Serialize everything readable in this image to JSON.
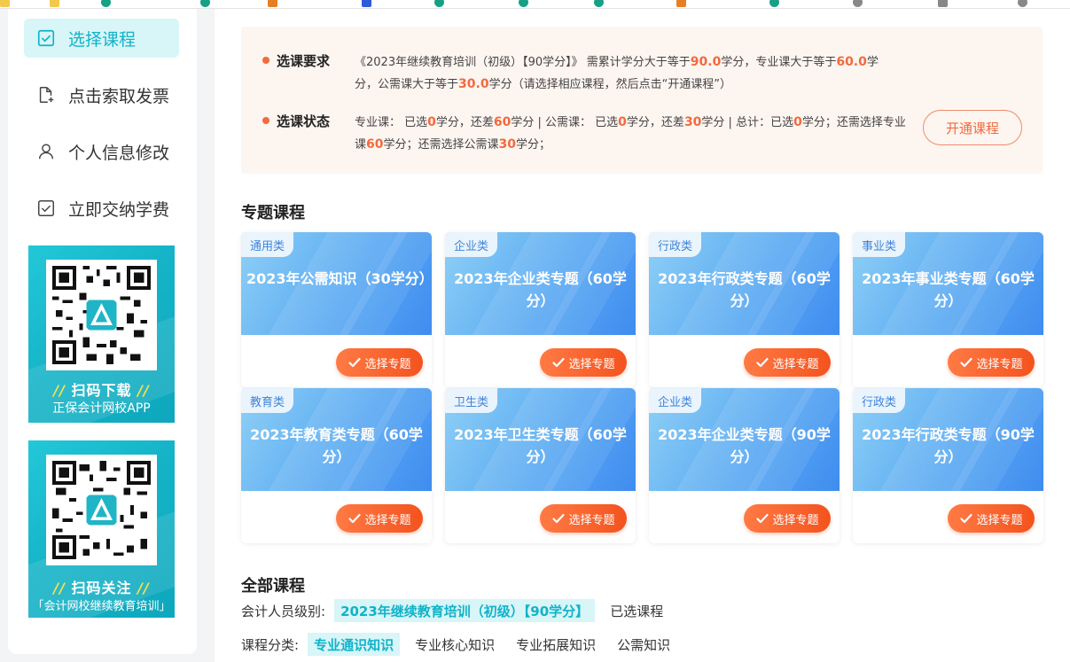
{
  "sidebar": {
    "items": [
      {
        "label": "选择课程",
        "icon": "checkbox-icon",
        "active": true
      },
      {
        "label": "点击索取发票",
        "icon": "file-add-icon",
        "active": false
      },
      {
        "label": "个人信息修改",
        "icon": "user-icon",
        "active": false
      },
      {
        "label": "立即交纳学费",
        "icon": "checkbox-icon",
        "active": false
      }
    ],
    "promos": [
      {
        "line1": "扫码下载",
        "line2": "正保会计网校APP"
      },
      {
        "line1": "扫码关注",
        "line2": "「会计网校继续教育培训」"
      }
    ]
  },
  "requirements": {
    "req_label": "选课要求",
    "req_text": {
      "p1": "《2023年继续教育培训（初级）【90学分】》 需累计学分大于等于",
      "v1": "90.0",
      "p2": "学分，专业课大于等于",
      "v2": "60.0",
      "p3": "学分，公需课大于等于",
      "v3": "30.0",
      "p4": "学分（请选择相应课程，然后点击“开通课程”）"
    },
    "status_label": "选课状态",
    "status_text": {
      "p1": "专业课：  已选",
      "v1": "0",
      "p2": "学分，还差",
      "v2": "60",
      "p3": "学分 | 公需课：  已选",
      "v3": "0",
      "p4": "学分，还差",
      "v4": "30",
      "p5": "学分 | 总计：已选",
      "v5": "0",
      "p6": "学分；还需选择专业课",
      "v6": "60",
      "p7": "学分；还需选择公需课",
      "v7": "30",
      "p8": "学分；"
    },
    "open_button": "开通课程"
  },
  "topics": {
    "title": "专题课程",
    "select_label": "选择专题",
    "cards": [
      {
        "tag": "通用类",
        "title": "2023年公需知识（30学分）"
      },
      {
        "tag": "企业类",
        "title": "2023年企业类专题（60学分）"
      },
      {
        "tag": "行政类",
        "title": "2023年行政类专题（60学分）"
      },
      {
        "tag": "事业类",
        "title": "2023年事业类专题（60学分）"
      },
      {
        "tag": "教育类",
        "title": "2023年教育类专题（60学分）"
      },
      {
        "tag": "卫生类",
        "title": "2023年卫生类专题（60学分）"
      },
      {
        "tag": "企业类",
        "title": "2023年企业类专题（90学分）"
      },
      {
        "tag": "行政类",
        "title": "2023年行政类专题（90学分）"
      }
    ]
  },
  "all_courses": {
    "title": "全部课程",
    "level_label": "会计人员级别:",
    "level_options": [
      "2023年继续教育培训（初级）【90学分】",
      "已选课程"
    ],
    "category_label": "课程分类:",
    "category_options": [
      "专业通识知识",
      "专业核心知识",
      "专业拓展知识",
      "公需知识"
    ]
  },
  "colors": {
    "accent": "#11b3c8",
    "highlight": "#f26a3e",
    "button_orange": "#f4531e"
  }
}
